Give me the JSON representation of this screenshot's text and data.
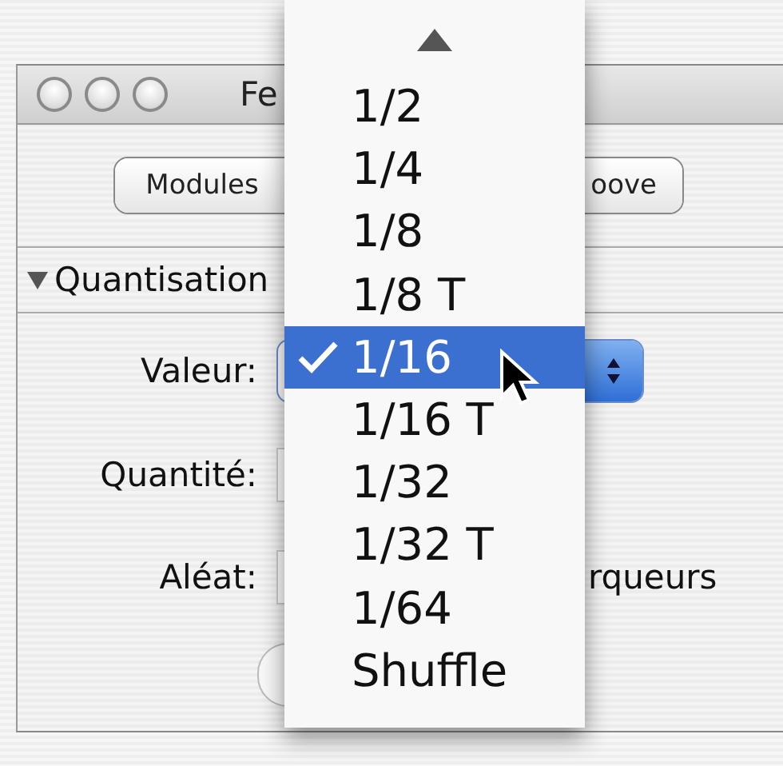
{
  "window": {
    "title": "Fe"
  },
  "segments": [
    {
      "label": "Modules"
    },
    {
      "label": "oove"
    }
  ],
  "section": {
    "title": "Quantisation",
    "expanded": true
  },
  "fields": [
    {
      "label": "Valeur:",
      "kind": "popup"
    },
    {
      "label": "Quantité:",
      "kind": "stepper"
    },
    {
      "label": "Aléat:",
      "kind": "stepper",
      "checkbox_label": "rqueurs"
    }
  ],
  "menu": {
    "items": [
      {
        "label": "1/2",
        "selected": false
      },
      {
        "label": "1/4",
        "selected": false
      },
      {
        "label": "1/8",
        "selected": false
      },
      {
        "label": "1/8 T",
        "selected": false
      },
      {
        "label": "1/16",
        "selected": true
      },
      {
        "label": "1/16 T",
        "selected": false
      },
      {
        "label": "1/32",
        "selected": false
      },
      {
        "label": "1/32 T",
        "selected": false
      },
      {
        "label": "1/64",
        "selected": false
      },
      {
        "label": "Shuffle",
        "selected": false
      }
    ]
  }
}
